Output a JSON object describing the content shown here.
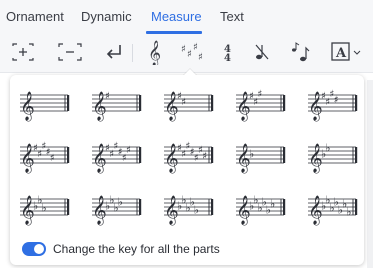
{
  "tabs": [
    {
      "label": "Ornament"
    },
    {
      "label": "Dynamic"
    },
    {
      "label": "Measure",
      "active": true
    },
    {
      "label": "Text"
    }
  ],
  "toolbar": {
    "items": [
      {
        "icon": "insert-measure-icon"
      },
      {
        "icon": "remove-measure-icon"
      },
      {
        "icon": "line-break-icon"
      },
      {
        "icon": "clef-icon"
      },
      {
        "icon": "key-signature-icon"
      },
      {
        "icon": "time-signature-icon"
      },
      {
        "icon": "pickup-measure-icon"
      },
      {
        "icon": "grace-notes-icon"
      },
      {
        "icon": "text-style-icon",
        "label": "A"
      }
    ]
  },
  "key_signatures": [
    {
      "name": "C major",
      "sharps": 0,
      "flats": 0
    },
    {
      "name": "G major",
      "sharps": 1,
      "flats": 0
    },
    {
      "name": "D major",
      "sharps": 2,
      "flats": 0
    },
    {
      "name": "A major",
      "sharps": 3,
      "flats": 0
    },
    {
      "name": "E major",
      "sharps": 4,
      "flats": 0
    },
    {
      "name": "B major",
      "sharps": 5,
      "flats": 0
    },
    {
      "name": "F# major",
      "sharps": 6,
      "flats": 0
    },
    {
      "name": "C# major",
      "sharps": 7,
      "flats": 0
    },
    {
      "name": "F major",
      "sharps": 0,
      "flats": 1
    },
    {
      "name": "Bb major",
      "sharps": 0,
      "flats": 2
    },
    {
      "name": "Eb major",
      "sharps": 0,
      "flats": 3
    },
    {
      "name": "Ab major",
      "sharps": 0,
      "flats": 4
    },
    {
      "name": "Db major",
      "sharps": 0,
      "flats": 5
    },
    {
      "name": "Gb major",
      "sharps": 0,
      "flats": 6
    },
    {
      "name": "Cb major",
      "sharps": 0,
      "flats": 7
    }
  ],
  "toggle": {
    "label": "Change the key for all the parts",
    "on": true
  },
  "colors": {
    "accent": "#2f6fe3",
    "text": "#2a2d34",
    "staff": "#2a2d34"
  }
}
